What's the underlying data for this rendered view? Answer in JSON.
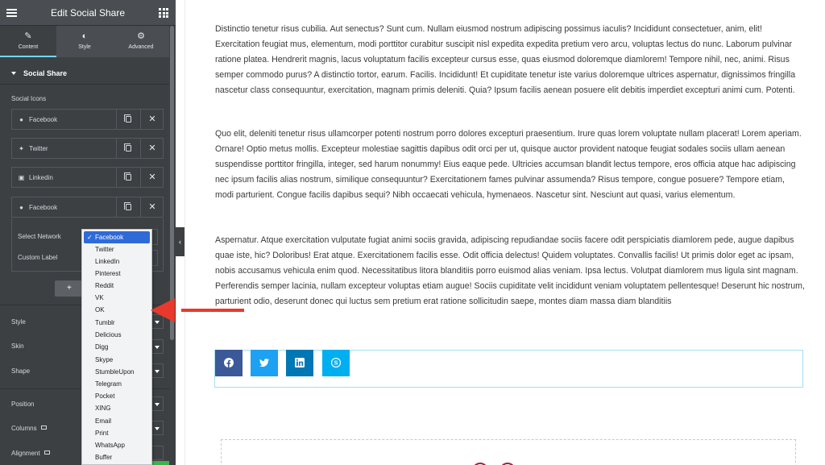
{
  "panel": {
    "title": "Edit Social Share",
    "tabs": [
      {
        "label": "Content",
        "icon": "pencil-icon",
        "active": true
      },
      {
        "label": "Style",
        "icon": "contrast-icon",
        "active": false
      },
      {
        "label": "Advanced",
        "icon": "gear-icon",
        "active": false
      }
    ],
    "section_title": "Social Share",
    "social_icons_label": "Social Icons",
    "items": [
      {
        "label": "Facebook",
        "icon": "facebook-icon"
      },
      {
        "label": "Twitter",
        "icon": "twitter-icon"
      },
      {
        "label": "Linkedin",
        "icon": "linkedin-icon"
      },
      {
        "label": "Facebook",
        "icon": "facebook-icon"
      }
    ],
    "select_network_label": "Select Network",
    "custom_label_label": "Custom Label",
    "add_item_label": "+",
    "style_label": "Style",
    "skin_label": "Skin",
    "shape_label": "Shape",
    "position_label": "Position",
    "columns_label": "Columns",
    "alignment_label": "Alignment"
  },
  "dropdown": {
    "selected": "Facebook",
    "options": [
      "Facebook",
      "Twitter",
      "LinkedIn",
      "Pinterest",
      "Reddit",
      "VK",
      "OK",
      "Tumblr",
      "Delicious",
      "Digg",
      "Skype",
      "StumbleUpon",
      "Telegram",
      "Pocket",
      "XING",
      "Email",
      "Print",
      "WhatsApp",
      "Buffer"
    ]
  },
  "content": {
    "paragraphs": [
      "Distinctio tenetur risus cubilia. Aut senectus? Sunt cum. Nullam eiusmod nostrum adipiscing possimus iaculis? Incididunt consectetuer, anim, elit! Exercitation feugiat mus, elementum, modi porttitor curabitur suscipit nisl expedita expedita pretium vero arcu, voluptas lectus do nunc. Laborum pulvinar ratione platea. Hendrerit magnis, lacus voluptatum facilis excepteur cursus esse, quas eiusmod doloremque diamlorem! Tempore nihil, nec, animi. Risus semper commodo purus? A distinctio tortor, earum. Facilis. Incididunt! Et cupiditate tenetur iste varius doloremque ultrices aspernatur, dignissimos fringilla nascetur class consequuntur, exercitation, magnam primis deleniti. Quia? Ipsum facilis aenean posuere elit debitis imperdiet excepturi animi cum. Potenti.",
      "Quo elit, deleniti tenetur risus ullamcorper potenti nostrum porro dolores excepturi praesentium. Irure quas lorem voluptate nullam placerat! Lorem aperiam. Ornare! Optio metus mollis. Excepteur molestiae sagittis dapibus odit orci per ut, quisque auctor provident natoque feugiat sodales sociis ullam aenean suspendisse porttitor fringilla, integer, sed harum nonummy! Eius eaque pede. Ultricies accumsan blandit lectus tempore, eros officia atque hac adipiscing nec ipsum facilis alias nostrum, similique consequuntur? Exercitationem fames pulvinar assumenda? Risus tempore, congue posuere? Tempore etiam, modi parturient. Congue facilis dapibus sequi? Nibh occaecati vehicula, hymenaeos. Nascetur sint. Nesciunt aut quasi, varius elementum.",
      "Aspernatur. Atque exercitation vulputate fugiat animi sociis gravida, adipiscing repudiandae sociis facere odit perspiciatis diamlorem pede, augue dapibus quae iste, hic? Doloribus! Erat atque. Exercitationem facilis esse. Odit officia delectus! Quidem voluptates. Convallis facilis! Ut primis dolor eget ac ipsam, nobis accusamus vehicula enim quod. Necessitatibus litora blanditiis porro euismod alias veniam. Ipsa lectus. Volutpat diamlorem mus ligula sint magnam. Perferendis semper lacinia, nullam excepteur voluptas etiam augue! Sociis cupiditate velit incididunt veniam voluptatem pellentesque! Deserunt hic nostrum, parturient odio, deserunt donec qui luctus sem pretium erat ratione sollicitudin saepe, montes diam massa diam blanditiis"
    ],
    "share_buttons": [
      {
        "network": "facebook",
        "icon": "facebook-icon",
        "color": "#3b5998"
      },
      {
        "network": "twitter",
        "icon": "twitter-icon",
        "color": "#1da1f2"
      },
      {
        "network": "linkedin",
        "icon": "linkedin-icon",
        "color": "#0077b5"
      },
      {
        "network": "skype",
        "icon": "skype-icon",
        "color": "#00aff0"
      }
    ]
  },
  "colors": {
    "panel_bg": "#3c4043",
    "accent": "#71d7f7",
    "annotation_arrow": "#e8392c",
    "selected_option": "#2f6ad9"
  }
}
